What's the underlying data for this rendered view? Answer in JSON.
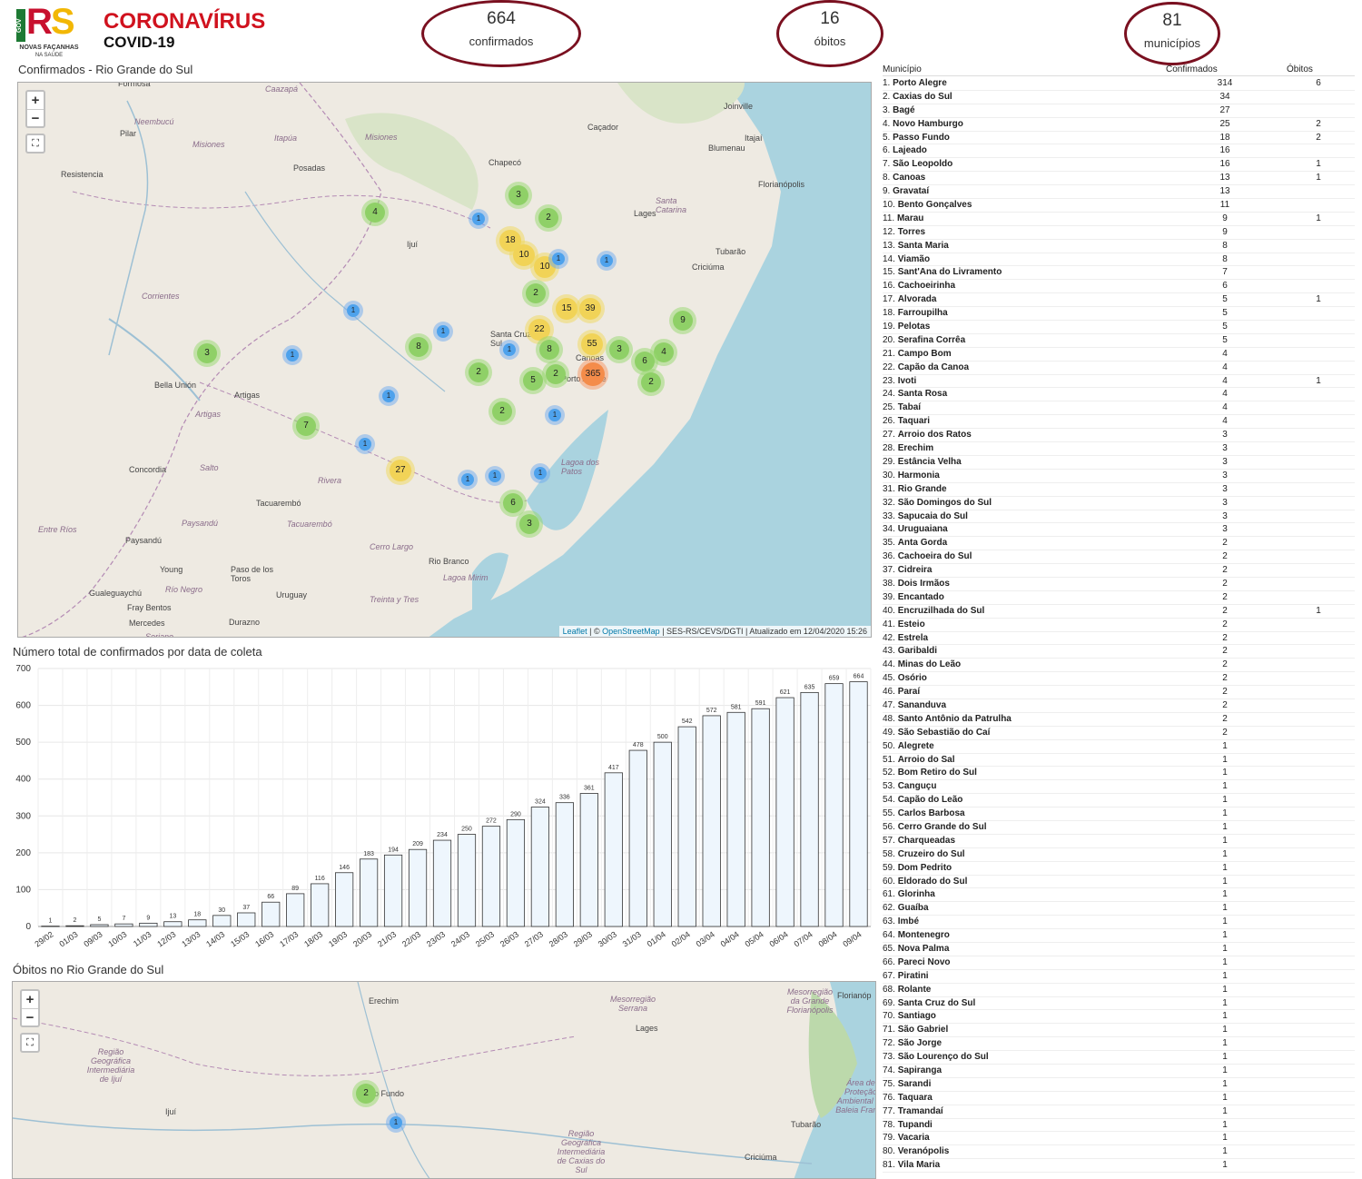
{
  "header": {
    "logo_gov": "GOV",
    "logo_r": "R",
    "logo_s": "S",
    "logo_sub": "NOVAS FAÇANHAS",
    "logo_sub2": "NA SAÚDE",
    "title": "CORONAVÍRUS",
    "subtitle": "COVID-19"
  },
  "stats": [
    {
      "value": "664",
      "label": "confirmados"
    },
    {
      "value": "16",
      "label": "óbitos"
    },
    {
      "value": "81",
      "label": "municípios"
    }
  ],
  "map1": {
    "title": "Confirmados - Rio Grande do Sul",
    "zoom_in": "+",
    "zoom_out": "−",
    "fullscreen": "⛶",
    "attrib_leaflet": "Leaflet",
    "attrib_sep": " | © ",
    "attrib_osm": "OpenStreetMap",
    "attrib_rest": " | SES-RS/CEVS/DGTI | Atualizado em 12/04/2020 15:26",
    "labels": [
      {
        "t": "Formosa",
        "italic": false
      },
      {
        "t": "Caazapá",
        "italic": true
      },
      {
        "t": "Neembucú",
        "italic": true
      },
      {
        "t": "Pilar",
        "italic": false
      },
      {
        "t": "Misiones",
        "italic": true
      },
      {
        "t": "Itapúa",
        "italic": true
      },
      {
        "t": "Misiones",
        "italic": true
      },
      {
        "t": "Resistencia",
        "italic": false
      },
      {
        "t": "Posadas",
        "italic": false
      },
      {
        "t": "Chapecó",
        "italic": false
      },
      {
        "t": "Caçador",
        "italic": false
      },
      {
        "t": "Joinville",
        "italic": false
      },
      {
        "t": "Blumenau",
        "italic": false
      },
      {
        "t": "Itajaí",
        "italic": false
      },
      {
        "t": "Florianópolis",
        "italic": false
      },
      {
        "t": "Santa Catarina",
        "italic": true
      },
      {
        "t": "Lages",
        "italic": false
      },
      {
        "t": "Tubarão",
        "italic": false
      },
      {
        "t": "Criciúma",
        "italic": false
      },
      {
        "t": "Ijuí",
        "italic": false
      },
      {
        "t": "Corrientes",
        "italic": true
      },
      {
        "t": "Bella Unión",
        "italic": false
      },
      {
        "t": "Artigas",
        "italic": false
      },
      {
        "t": "Artigas",
        "italic": true
      },
      {
        "t": "Santa Cruz do Sul",
        "italic": false
      },
      {
        "t": "Canoas",
        "italic": false
      },
      {
        "t": "Porto Alegre",
        "italic": false
      },
      {
        "t": "Concordia",
        "italic": false
      },
      {
        "t": "Salto",
        "italic": true
      },
      {
        "t": "Rivera",
        "italic": true
      },
      {
        "t": "Tacuarembó",
        "italic": false
      },
      {
        "t": "Entre Ríos",
        "italic": true
      },
      {
        "t": "Paysandú",
        "italic": true
      },
      {
        "t": "Tacuarembó",
        "italic": true
      },
      {
        "t": "Paysandú",
        "italic": false
      },
      {
        "t": "Cerro Largo",
        "italic": true
      },
      {
        "t": "Rio Branco",
        "italic": false
      },
      {
        "t": "Young",
        "italic": false
      },
      {
        "t": "Paso de los Toros",
        "italic": false
      },
      {
        "t": "Río Negro",
        "italic": true
      },
      {
        "t": "Uruguay",
        "italic": false
      },
      {
        "t": "Treinta y Tres",
        "italic": true
      },
      {
        "t": "Gualeguaychú",
        "italic": false
      },
      {
        "t": "Fray Bentos",
        "italic": false
      },
      {
        "t": "Mercedes",
        "italic": false
      },
      {
        "t": "Durazno",
        "italic": false
      },
      {
        "t": "Lagoa dos Patos",
        "italic": true
      },
      {
        "t": "Lagoa Mirim",
        "italic": true
      },
      {
        "t": "Soriano",
        "italic": true
      }
    ],
    "clusters": [
      "4",
      "3",
      "2",
      "1",
      "18",
      "10",
      "10",
      "1",
      "1",
      "2",
      "1",
      "15",
      "39",
      "1",
      "22",
      "9",
      "8",
      "3",
      "1",
      "8",
      "55",
      "3",
      "1",
      "4",
      "6",
      "2",
      "5",
      "2",
      "365",
      "2",
      "1",
      "2",
      "1",
      "7",
      "1",
      "27",
      "1",
      "1",
      "1",
      "6",
      "3"
    ]
  },
  "chart": {
    "title": "Número total de confirmados por data de coleta"
  },
  "chart_data": {
    "type": "bar",
    "title": "Número total de confirmados por data de coleta",
    "categories": [
      "29/02",
      "01/03",
      "09/03",
      "10/03",
      "11/03",
      "12/03",
      "13/03",
      "14/03",
      "15/03",
      "16/03",
      "17/03",
      "18/03",
      "19/03",
      "20/03",
      "21/03",
      "22/03",
      "23/03",
      "24/03",
      "25/03",
      "26/03",
      "27/03",
      "28/03",
      "29/03",
      "30/03",
      "31/03",
      "01/04",
      "02/04",
      "03/04",
      "04/04",
      "05/04",
      "06/04",
      "07/04",
      "08/04",
      "09/04"
    ],
    "values": [
      1,
      2,
      5,
      7,
      9,
      13,
      18,
      30,
      37,
      66,
      89,
      116,
      146,
      183,
      194,
      209,
      234,
      250,
      272,
      290,
      324,
      336,
      361,
      417,
      478,
      500,
      542,
      572,
      581,
      591,
      621,
      635,
      659,
      664
    ],
    "ylim": [
      0,
      700
    ],
    "yticks": [
      0,
      100,
      200,
      300,
      400,
      500,
      600,
      700
    ],
    "grid": true,
    "bar_color": "#eef6fd"
  },
  "map2": {
    "title": "Óbitos no Rio Grande do Sul",
    "zoom_in": "+",
    "zoom_out": "−",
    "fullscreen": "⛶",
    "labels": [
      {
        "t": "Mesorregião da Grande Florianópolis",
        "italic": true
      },
      {
        "t": "Florianóp",
        "italic": false
      },
      {
        "t": "Erechim",
        "italic": false
      },
      {
        "t": "Mesorregião Serrana",
        "italic": true
      },
      {
        "t": "Lages",
        "italic": false
      },
      {
        "t": "Região Geográfica Intermediária de Ijuí",
        "italic": true
      },
      {
        "t": "Passo Fundo",
        "italic": false
      },
      {
        "t": "Ijuí",
        "italic": false
      },
      {
        "t": "Região Geográfica Intermediária de Caxias do Sul",
        "italic": true
      },
      {
        "t": "Tubarão",
        "italic": false
      },
      {
        "t": "Criciúma",
        "italic": false
      },
      {
        "t": "Área de Proteção Ambiental da Baleia Franca",
        "italic": true
      }
    ],
    "clusters": [
      "2",
      "1"
    ]
  },
  "table": {
    "headers": [
      "Município",
      "Confirmados",
      "Óbitos"
    ],
    "rows": [
      [
        "1.",
        "Porto Alegre",
        "314",
        "6"
      ],
      [
        "2.",
        "Caxias do Sul",
        "34",
        ""
      ],
      [
        "3.",
        "Bagé",
        "27",
        ""
      ],
      [
        "4.",
        "Novo Hamburgo",
        "25",
        "2"
      ],
      [
        "5.",
        "Passo Fundo",
        "18",
        "2"
      ],
      [
        "6.",
        "Lajeado",
        "16",
        ""
      ],
      [
        "7.",
        "São Leopoldo",
        "16",
        "1"
      ],
      [
        "8.",
        "Canoas",
        "13",
        "1"
      ],
      [
        "9.",
        "Gravataí",
        "13",
        ""
      ],
      [
        "10.",
        "Bento Gonçalves",
        "11",
        ""
      ],
      [
        "11.",
        "Marau",
        "9",
        "1"
      ],
      [
        "12.",
        "Torres",
        "9",
        ""
      ],
      [
        "13.",
        "Santa Maria",
        "8",
        ""
      ],
      [
        "14.",
        "Viamão",
        "8",
        ""
      ],
      [
        "15.",
        "Sant'Ana do Livramento",
        "7",
        ""
      ],
      [
        "16.",
        "Cachoeirinha",
        "6",
        ""
      ],
      [
        "17.",
        "Alvorada",
        "5",
        "1"
      ],
      [
        "18.",
        "Farroupilha",
        "5",
        ""
      ],
      [
        "19.",
        "Pelotas",
        "5",
        ""
      ],
      [
        "20.",
        "Serafina Corrêa",
        "5",
        ""
      ],
      [
        "21.",
        "Campo Bom",
        "4",
        ""
      ],
      [
        "22.",
        "Capão da Canoa",
        "4",
        ""
      ],
      [
        "23.",
        "Ivoti",
        "4",
        "1"
      ],
      [
        "24.",
        "Santa Rosa",
        "4",
        ""
      ],
      [
        "25.",
        "Tabaí",
        "4",
        ""
      ],
      [
        "26.",
        "Taquari",
        "4",
        ""
      ],
      [
        "27.",
        "Arroio dos Ratos",
        "3",
        ""
      ],
      [
        "28.",
        "Erechim",
        "3",
        ""
      ],
      [
        "29.",
        "Estância Velha",
        "3",
        ""
      ],
      [
        "30.",
        "Harmonia",
        "3",
        ""
      ],
      [
        "31.",
        "Rio Grande",
        "3",
        ""
      ],
      [
        "32.",
        "São Domingos do Sul",
        "3",
        ""
      ],
      [
        "33.",
        "Sapucaia do Sul",
        "3",
        ""
      ],
      [
        "34.",
        "Uruguaiana",
        "3",
        ""
      ],
      [
        "35.",
        "Anta Gorda",
        "2",
        ""
      ],
      [
        "36.",
        "Cachoeira do Sul",
        "2",
        ""
      ],
      [
        "37.",
        "Cidreira",
        "2",
        ""
      ],
      [
        "38.",
        "Dois Irmãos",
        "2",
        ""
      ],
      [
        "39.",
        "Encantado",
        "2",
        ""
      ],
      [
        "40.",
        "Encruzilhada do Sul",
        "2",
        "1"
      ],
      [
        "41.",
        "Esteio",
        "2",
        ""
      ],
      [
        "42.",
        "Estrela",
        "2",
        ""
      ],
      [
        "43.",
        "Garibaldi",
        "2",
        ""
      ],
      [
        "44.",
        "Minas do Leão",
        "2",
        ""
      ],
      [
        "45.",
        "Osório",
        "2",
        ""
      ],
      [
        "46.",
        "Paraí",
        "2",
        ""
      ],
      [
        "47.",
        "Sananduva",
        "2",
        ""
      ],
      [
        "48.",
        "Santo Antônio da Patrulha",
        "2",
        ""
      ],
      [
        "49.",
        "São Sebastião do Caí",
        "2",
        ""
      ],
      [
        "50.",
        "Alegrete",
        "1",
        ""
      ],
      [
        "51.",
        "Arroio do Sal",
        "1",
        ""
      ],
      [
        "52.",
        "Bom Retiro do Sul",
        "1",
        ""
      ],
      [
        "53.",
        "Canguçu",
        "1",
        ""
      ],
      [
        "54.",
        "Capão do Leão",
        "1",
        ""
      ],
      [
        "55.",
        "Carlos Barbosa",
        "1",
        ""
      ],
      [
        "56.",
        "Cerro Grande do Sul",
        "1",
        ""
      ],
      [
        "57.",
        "Charqueadas",
        "1",
        ""
      ],
      [
        "58.",
        "Cruzeiro do Sul",
        "1",
        ""
      ],
      [
        "59.",
        "Dom Pedrito",
        "1",
        ""
      ],
      [
        "60.",
        "Eldorado do Sul",
        "1",
        ""
      ],
      [
        "61.",
        "Glorinha",
        "1",
        ""
      ],
      [
        "62.",
        "Guaíba",
        "1",
        ""
      ],
      [
        "63.",
        "Imbé",
        "1",
        ""
      ],
      [
        "64.",
        "Montenegro",
        "1",
        ""
      ],
      [
        "65.",
        "Nova Palma",
        "1",
        ""
      ],
      [
        "66.",
        "Pareci Novo",
        "1",
        ""
      ],
      [
        "67.",
        "Piratini",
        "1",
        ""
      ],
      [
        "68.",
        "Rolante",
        "1",
        ""
      ],
      [
        "69.",
        "Santa Cruz do Sul",
        "1",
        ""
      ],
      [
        "70.",
        "Santiago",
        "1",
        ""
      ],
      [
        "71.",
        "São Gabriel",
        "1",
        ""
      ],
      [
        "72.",
        "São Jorge",
        "1",
        ""
      ],
      [
        "73.",
        "São Lourenço do Sul",
        "1",
        ""
      ],
      [
        "74.",
        "Sapiranga",
        "1",
        ""
      ],
      [
        "75.",
        "Sarandi",
        "1",
        ""
      ],
      [
        "76.",
        "Taquara",
        "1",
        ""
      ],
      [
        "77.",
        "Tramandaí",
        "1",
        ""
      ],
      [
        "78.",
        "Tupandi",
        "1",
        ""
      ],
      [
        "79.",
        "Vacaria",
        "1",
        ""
      ],
      [
        "80.",
        "Veranópolis",
        "1",
        ""
      ],
      [
        "81.",
        "Vila Maria",
        "1",
        ""
      ]
    ]
  }
}
